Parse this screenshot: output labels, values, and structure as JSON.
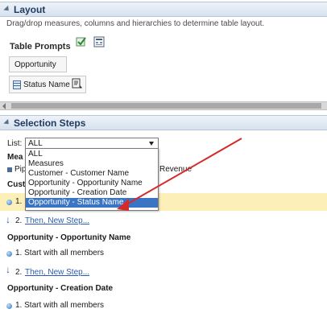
{
  "layout": {
    "header": "Layout",
    "hint": "Drag/drop measures, columns and hierarchies to determine table layout.",
    "table_prompts_label": "Table Prompts",
    "prompt_top_label": "Opportunity",
    "prompt_item_label": "Status Name"
  },
  "selection_steps": {
    "header": "Selection Steps",
    "list_label": "List:",
    "list_value": "ALL",
    "list_options": [
      "ALL",
      "Measures",
      "Customer - Customer Name",
      "Opportunity - Opportunity Name",
      "Opportunity - Creation Date",
      "Opportunity - Status Name"
    ],
    "selected_option_index": 5,
    "measures_heading_partial": "Mea",
    "measures_item_partial": "Pip",
    "measures_item_right": "Revenue",
    "customer_heading_partial": "Cust",
    "customer_step1_partial": "1.",
    "customer_step2": "2.",
    "then_new_step": "Then, New Step...",
    "opp_name_heading": "Opportunity - Opportunity Name",
    "step_start_all": "1. Start with all members",
    "step2_number": "2.",
    "creation_date_heading": "Opportunity - Creation Date"
  }
}
